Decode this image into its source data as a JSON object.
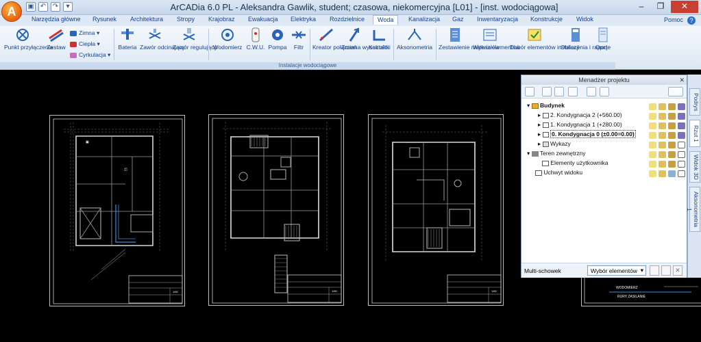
{
  "title": "ArCADia 6.0 PL - Aleksandra Gawlik, student; czasowa, niekomercyjna [L01] - [inst. wodociągowa]",
  "tabs": [
    "Narzędzia główne",
    "Rysunek",
    "Architektura",
    "Stropy",
    "Krajobraz",
    "Ewakuacja",
    "Elektryka",
    "Rozdzielnice",
    "Woda",
    "Kanalizacja",
    "Gaz",
    "Inwentaryzacja",
    "Konstrukcje",
    "Widok"
  ],
  "active_tab": "Woda",
  "help_label": "Pomoc",
  "ribbon": {
    "group_label": "Instalacje wodociągowe",
    "buttons": {
      "punkt": "Punkt przyłączenia",
      "zestaw": "Zestaw",
      "zimna": "Zimna",
      "ciepla": "Ciepła",
      "cyrkulacja": "Cyrkulacja",
      "bateria": "Bateria",
      "zawor_odc": "Zawór odcinający",
      "zawor_reg": "Zawór regulujący",
      "wodomierz": "Wodomierz",
      "cwu": "C.W.U.",
      "pompa": "Pompa",
      "filtr": "Filtr",
      "kreator": "Kreator połączeń",
      "zmiana": "Zmiana wysokości",
      "krsztalki": "Kształtki",
      "aksonometria": "Aksonometria",
      "zestawienie": "Zestawienie materiałów",
      "wykaz": "Wykaz elementów",
      "dobor": "Dobór elementów instalacji",
      "obliczenia": "Obliczenia i raport",
      "opcje": "Opcje"
    }
  },
  "project_manager": {
    "title": "Menadżer projektu",
    "tree": [
      {
        "label": "Budynek",
        "level": 0,
        "bold": true
      },
      {
        "label": "2. Kondygnacja 2 (+560.00)",
        "level": 1
      },
      {
        "label": "1. Kondygnacja 1 (+280.00)",
        "level": 1
      },
      {
        "label": "0. Kondygnacja 0 (±0.00=0.00)",
        "level": 1,
        "selected": true
      },
      {
        "label": "Wykazy",
        "level": 1
      },
      {
        "label": "Teren zewnętrzny",
        "level": 0
      },
      {
        "label": "Elementy użytkownika",
        "level": 1
      },
      {
        "label": "Uchwyt widoku",
        "level": 0
      }
    ],
    "multi_clipboard": "Multi-schowek",
    "select_elements": "Wybór elementów"
  },
  "side_tabs": [
    "Podrys",
    "Rzut 1",
    "Widok 3D",
    "Aksonometria 1"
  ],
  "drawing": {
    "sheet_numbers": [
      "1/60",
      "1/60",
      "1/60"
    ],
    "partial_label_1": "WODOMIERZ",
    "partial_label_2": "RURY ZASILANIE"
  },
  "colors": {
    "ribbon_bg": "#dde8f4",
    "accent": "#15428b",
    "canvas_bg": "#000000"
  }
}
